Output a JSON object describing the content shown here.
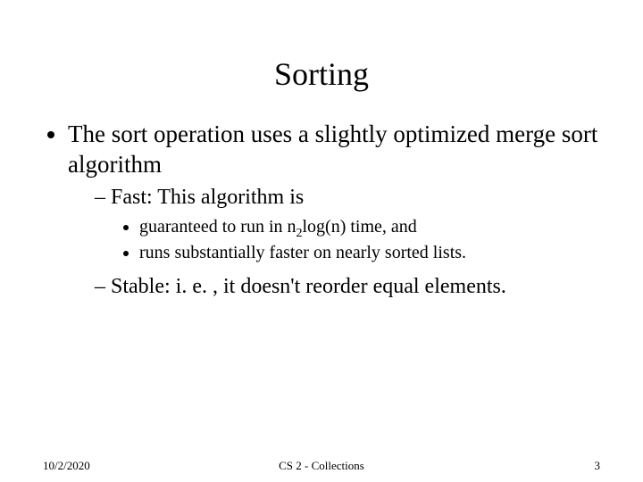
{
  "title": "Sorting",
  "bullets": {
    "main": "The sort operation uses a slightly optimized merge sort algorithm",
    "fast_label": "Fast: This algorithm is",
    "fast_sub1_pre": "guaranteed to run in n",
    "fast_sub1_sub": "2",
    "fast_sub1_post": "log(n) time, and",
    "fast_sub2": "runs substantially faster on nearly sorted lists.",
    "stable": "Stable: i. e. , it doesn't reorder equal elements."
  },
  "footer": {
    "date": "10/2/2020",
    "center": "CS 2 - Collections",
    "page": "3"
  }
}
